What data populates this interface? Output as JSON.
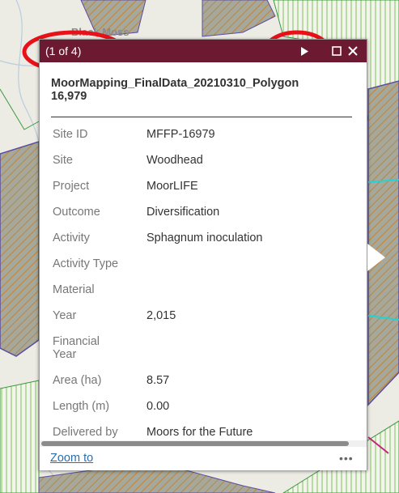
{
  "map": {
    "place_label": "Black Moss",
    "colors": {
      "background": "#ecebe4",
      "hatch_fill": "#a5a89a",
      "hatch_line": "#c0853a",
      "outline_purple": "#5a4f9e",
      "outline_green": "#3a9a3a",
      "outline_cyan": "#22d4d4",
      "outline_magenta": "#c8247a",
      "stream": "#b8cde0"
    }
  },
  "popup": {
    "page_count": "(1 of 4)",
    "title": "MoorMapping_FinalData_20210310_Polygon\n16,979",
    "header_color": "#6b1a32",
    "icons": {
      "next": "next-arrow-icon",
      "maximize": "maximize-icon",
      "close": "close-icon"
    },
    "attributes": [
      {
        "key": "Site ID",
        "value": "MFFP-16979"
      },
      {
        "key": "Site",
        "value": "Woodhead"
      },
      {
        "key": "Project",
        "value": "MoorLIFE"
      },
      {
        "key": "Outcome",
        "value": "Diversification"
      },
      {
        "key": "Activity",
        "value": "Sphagnum inoculation"
      },
      {
        "key": "Activity Type",
        "value": ""
      },
      {
        "key": "Material",
        "value": ""
      },
      {
        "key": "Year",
        "value": "2,015"
      },
      {
        "key": "Financial\nYear",
        "value": ""
      },
      {
        "key": "Area (ha)",
        "value": "8.57"
      },
      {
        "key": "Length (m)",
        "value": "0.00"
      },
      {
        "key": "Delivered by",
        "value": "Moors for the Future"
      }
    ],
    "footer": {
      "zoom_label": "Zoom to",
      "more_label": "•••"
    }
  },
  "annotations": {
    "highlight_color": "#e8111a"
  }
}
